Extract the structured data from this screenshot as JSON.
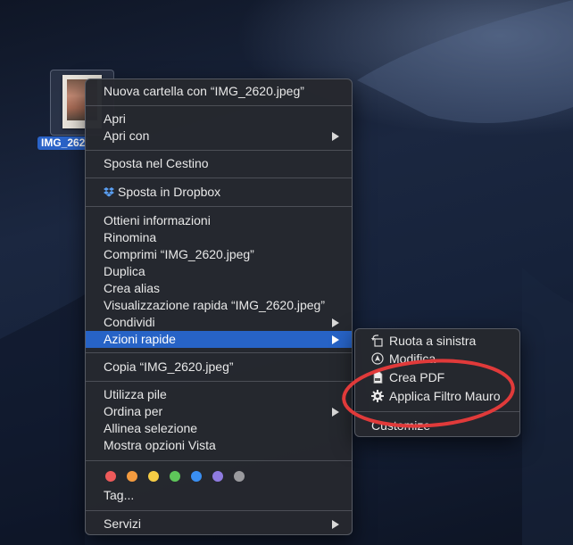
{
  "desktop": {
    "file_label": "IMG_262"
  },
  "context_menu": {
    "new_folder": "Nuova cartella con “IMG_2620.jpeg”",
    "open": "Apri",
    "open_with": "Apri con",
    "move_to_trash": "Sposta nel Cestino",
    "move_to_dropbox": "Sposta in Dropbox",
    "get_info": "Ottieni informazioni",
    "rename": "Rinomina",
    "compress": "Comprimi “IMG_2620.jpeg”",
    "duplicate": "Duplica",
    "make_alias": "Crea alias",
    "quick_look": "Visualizzazione rapida “IMG_2620.jpeg”",
    "share": "Condividi",
    "quick_actions": "Azioni rapide",
    "copy": "Copia “IMG_2620.jpeg”",
    "use_stacks": "Utilizza pile",
    "sort_by": "Ordina per",
    "clean_up_selection": "Allinea selezione",
    "show_view_options": "Mostra opzioni Vista",
    "tags": "Tag...",
    "services": "Servizi",
    "tag_colors": [
      "#ee5a5a",
      "#f49b3f",
      "#f6cc45",
      "#5ec55a",
      "#3a8ff2",
      "#8f7be0",
      "#9a9a9e"
    ]
  },
  "submenu": {
    "rotate_left": "Ruota a sinistra",
    "markup": "Modifica",
    "create_pdf": "Crea PDF",
    "apply_filter": "Applica Filtro Mauro",
    "customize": "Customize"
  },
  "colors": {
    "highlight": "#2763c6",
    "annotation": "#e03a3a"
  }
}
